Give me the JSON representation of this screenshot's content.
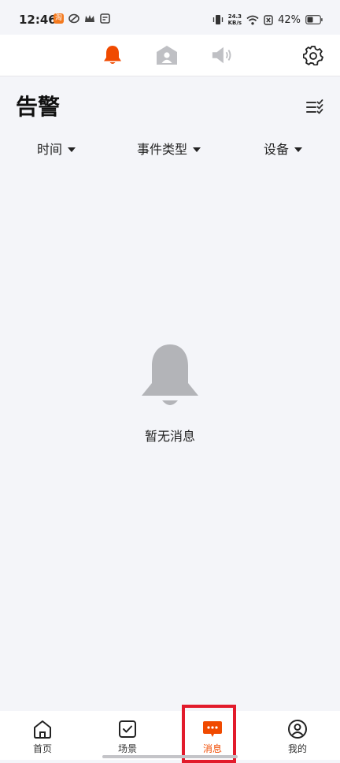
{
  "status_bar": {
    "time": "12:46",
    "app_badge": "淘",
    "net_speed_value": "24.3",
    "net_speed_unit": "KB/s",
    "battery": "42%"
  },
  "top_tabs": [
    {
      "icon": "bell-icon",
      "active": true
    },
    {
      "icon": "contact-icon",
      "active": false
    },
    {
      "icon": "speaker-icon",
      "active": false
    }
  ],
  "header": {
    "title": "告警"
  },
  "filters": {
    "time": "时间",
    "event_type": "事件类型",
    "device": "设备"
  },
  "empty_state": {
    "message": "暂无消息"
  },
  "bottom_nav": {
    "home": "首页",
    "scene": "场景",
    "messages": "消息",
    "mine": "我的"
  },
  "colors": {
    "accent": "#f04a00",
    "inactive_icon": "#bfc0c4",
    "empty_bell": "#b3b4b8",
    "highlight": "#e21b2b"
  }
}
